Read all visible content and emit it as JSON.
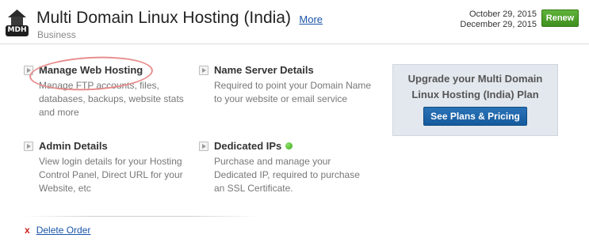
{
  "header": {
    "logo_text": "MDH",
    "title": "Multi Domain Linux Hosting (India)",
    "more_label": "More",
    "subtitle": "Business",
    "date_start": "October 29, 2015",
    "date_end": "December 29, 2015",
    "renew_label": "Renew"
  },
  "items": [
    {
      "title": "Manage Web Hosting",
      "desc": "Manage FTP accounts, files, databases, backups, website stats and more"
    },
    {
      "title": "Name Server Details",
      "desc": "Required to point your Domain Name to your website or email service"
    },
    {
      "title": "Admin Details",
      "desc": "View login details for your Hosting Control Panel, Direct URL for your Website, etc"
    },
    {
      "title": "Dedicated IPs",
      "desc": "Purchase and manage your Dedicated IP, required to purchase an SSL Certificate."
    }
  ],
  "upgrade": {
    "text": "Upgrade your Multi Domain Linux Hosting (India) Plan",
    "button_label": "See Plans & Pricing"
  },
  "delete": {
    "icon": "x-icon",
    "x_glyph": "x",
    "label": "Delete Order"
  },
  "colors": {
    "renew_green": "#4aa02c",
    "plans_blue": "#1c63a8",
    "link_blue": "#1a55a8",
    "status_green": "#3aa51a"
  }
}
